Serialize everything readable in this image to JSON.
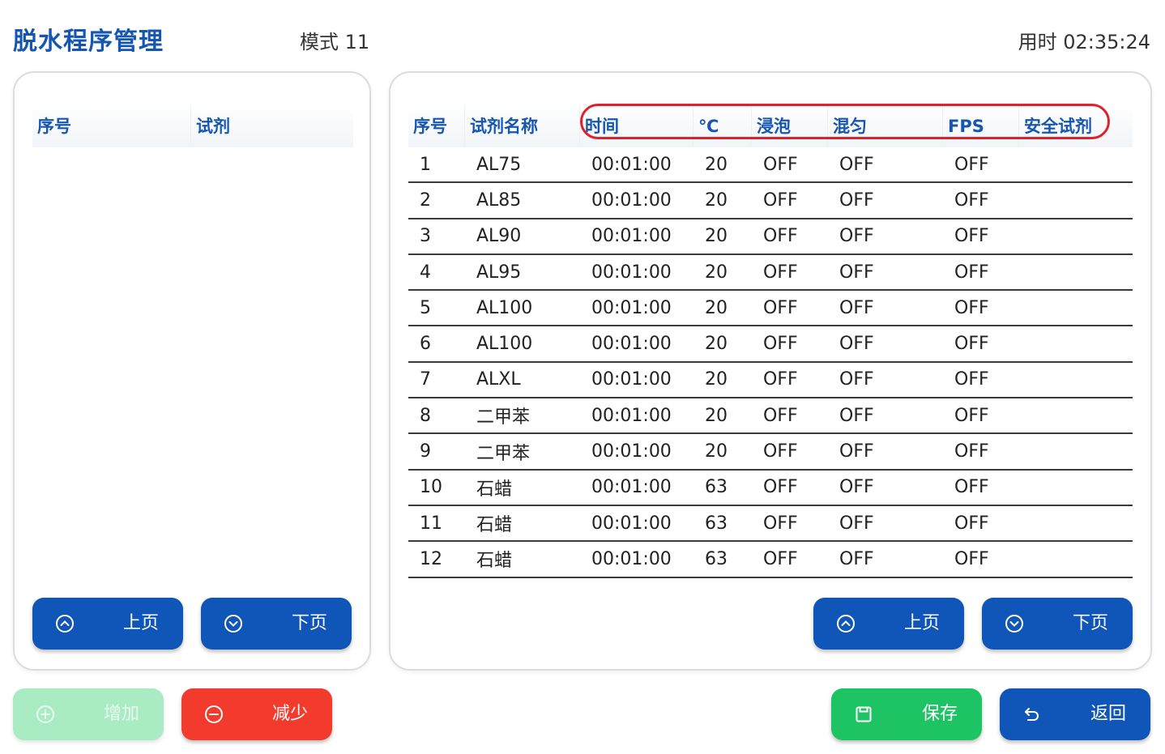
{
  "header": {
    "title": "脱水程序管理",
    "mode": "模式 11",
    "elapsed": "用时 02:35:24"
  },
  "left_panel": {
    "columns": [
      "序号",
      "试剂"
    ],
    "rows": [],
    "prev_label": "上页",
    "next_label": "下页"
  },
  "right_panel": {
    "columns": [
      "序号",
      "试剂名称",
      "时间",
      "℃",
      "浸泡",
      "混匀",
      "FPS",
      "安全试剂"
    ],
    "rows": [
      [
        "1",
        "AL75",
        "00:01:00",
        "20",
        "OFF",
        "OFF",
        "OFF",
        ""
      ],
      [
        "2",
        "AL85",
        "00:01:00",
        "20",
        "OFF",
        "OFF",
        "OFF",
        ""
      ],
      [
        "3",
        "AL90",
        "00:01:00",
        "20",
        "OFF",
        "OFF",
        "OFF",
        ""
      ],
      [
        "4",
        "AL95",
        "00:01:00",
        "20",
        "OFF",
        "OFF",
        "OFF",
        ""
      ],
      [
        "5",
        "AL100",
        "00:01:00",
        "20",
        "OFF",
        "OFF",
        "OFF",
        ""
      ],
      [
        "6",
        "AL100",
        "00:01:00",
        "20",
        "OFF",
        "OFF",
        "OFF",
        ""
      ],
      [
        "7",
        "ALXL",
        "00:01:00",
        "20",
        "OFF",
        "OFF",
        "OFF",
        ""
      ],
      [
        "8",
        "二甲苯",
        "00:01:00",
        "20",
        "OFF",
        "OFF",
        "OFF",
        ""
      ],
      [
        "9",
        "二甲苯",
        "00:01:00",
        "20",
        "OFF",
        "OFF",
        "OFF",
        ""
      ],
      [
        "10",
        "石蜡",
        "00:01:00",
        "63",
        "OFF",
        "OFF",
        "OFF",
        ""
      ],
      [
        "11",
        "石蜡",
        "00:01:00",
        "63",
        "OFF",
        "OFF",
        "OFF",
        ""
      ],
      [
        "12",
        "石蜡",
        "00:01:00",
        "63",
        "OFF",
        "OFF",
        "OFF",
        ""
      ]
    ],
    "prev_label": "上页",
    "next_label": "下页"
  },
  "actions": {
    "add_label": "增加",
    "remove_label": "减少",
    "save_label": "保存",
    "back_label": "返回"
  },
  "icons": {
    "prev": "chevron-up-circle-icon",
    "next": "chevron-down-circle-icon",
    "add": "plus-circle-icon",
    "remove": "minus-circle-icon",
    "save": "save-icon",
    "back": "return-arrow-icon"
  },
  "colors": {
    "primary_blue": "#0f56b8",
    "title_blue": "#1556b0",
    "save_green": "#1ec363",
    "remove_red": "#f33b2d",
    "disabled_green": "#a9ecc4",
    "highlight_red": "#e0202a"
  }
}
